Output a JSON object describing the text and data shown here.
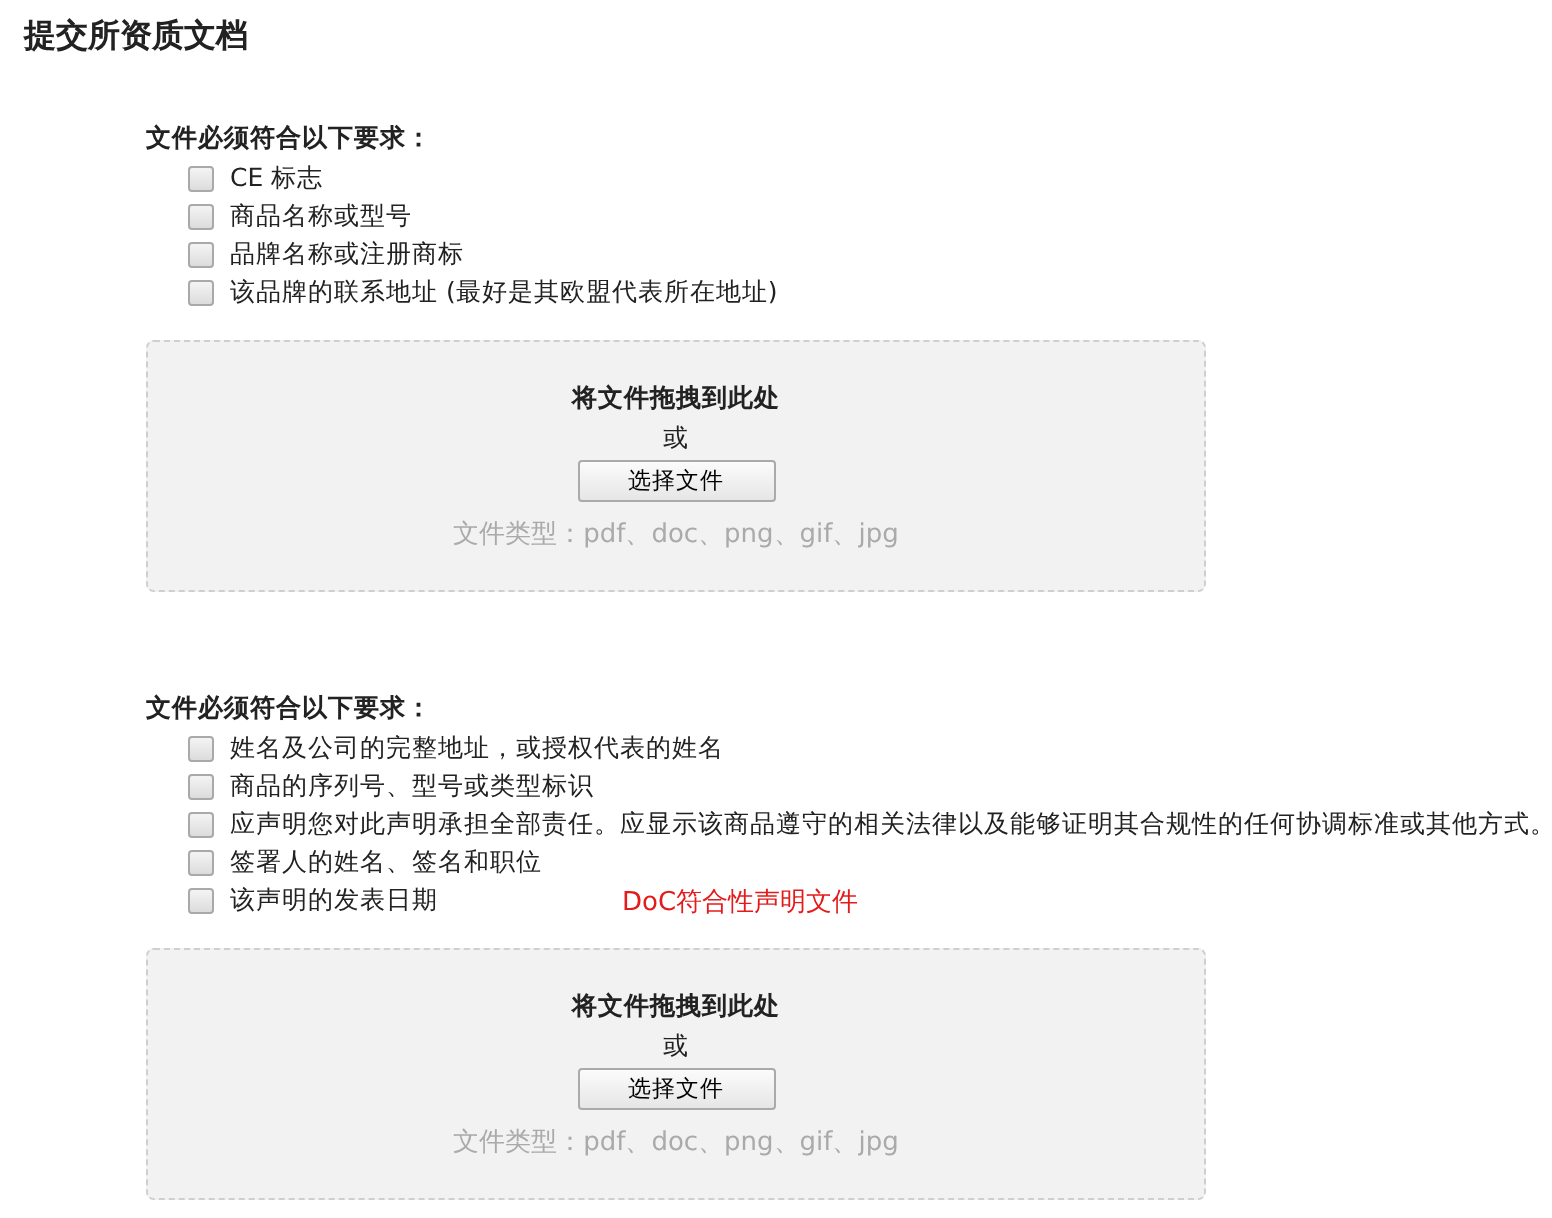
{
  "title": "提交所资质文档",
  "sections": [
    {
      "heading": "文件必须符合以下要求：",
      "items": [
        {
          "label": "CE 标志",
          "checked": false
        },
        {
          "label": "商品名称或型号",
          "checked": false
        },
        {
          "label": "品牌名称或注册商标",
          "checked": false
        },
        {
          "label": "该品牌的联系地址 (最好是其欧盟代表所在地址)",
          "checked": false
        }
      ],
      "dropzone": {
        "title": "将文件拖拽到此处",
        "or": "或",
        "button": "选择文件",
        "types": "文件类型：pdf、doc、png、gif、jpg"
      }
    },
    {
      "heading": "文件必须符合以下要求：",
      "items": [
        {
          "label": "姓名及公司的完整地址，或授权代表的姓名",
          "checked": false
        },
        {
          "label": "商品的序列号、型号或类型标识",
          "checked": false
        },
        {
          "label": "应声明您对此声明承担全部责任。应显示该商品遵守的相关法律以及能够证明其合规性的任何协调标准或其他方式。",
          "checked": false
        },
        {
          "label": "签署人的姓名、签名和职位",
          "checked": false
        },
        {
          "label": "该声明的发表日期",
          "checked": false
        }
      ],
      "note": "DoC符合性声明文件",
      "dropzone": {
        "title": "将文件拖拽到此处",
        "or": "或",
        "button": "选择文件",
        "types": "文件类型：pdf、doc、png、gif、jpg"
      }
    }
  ]
}
